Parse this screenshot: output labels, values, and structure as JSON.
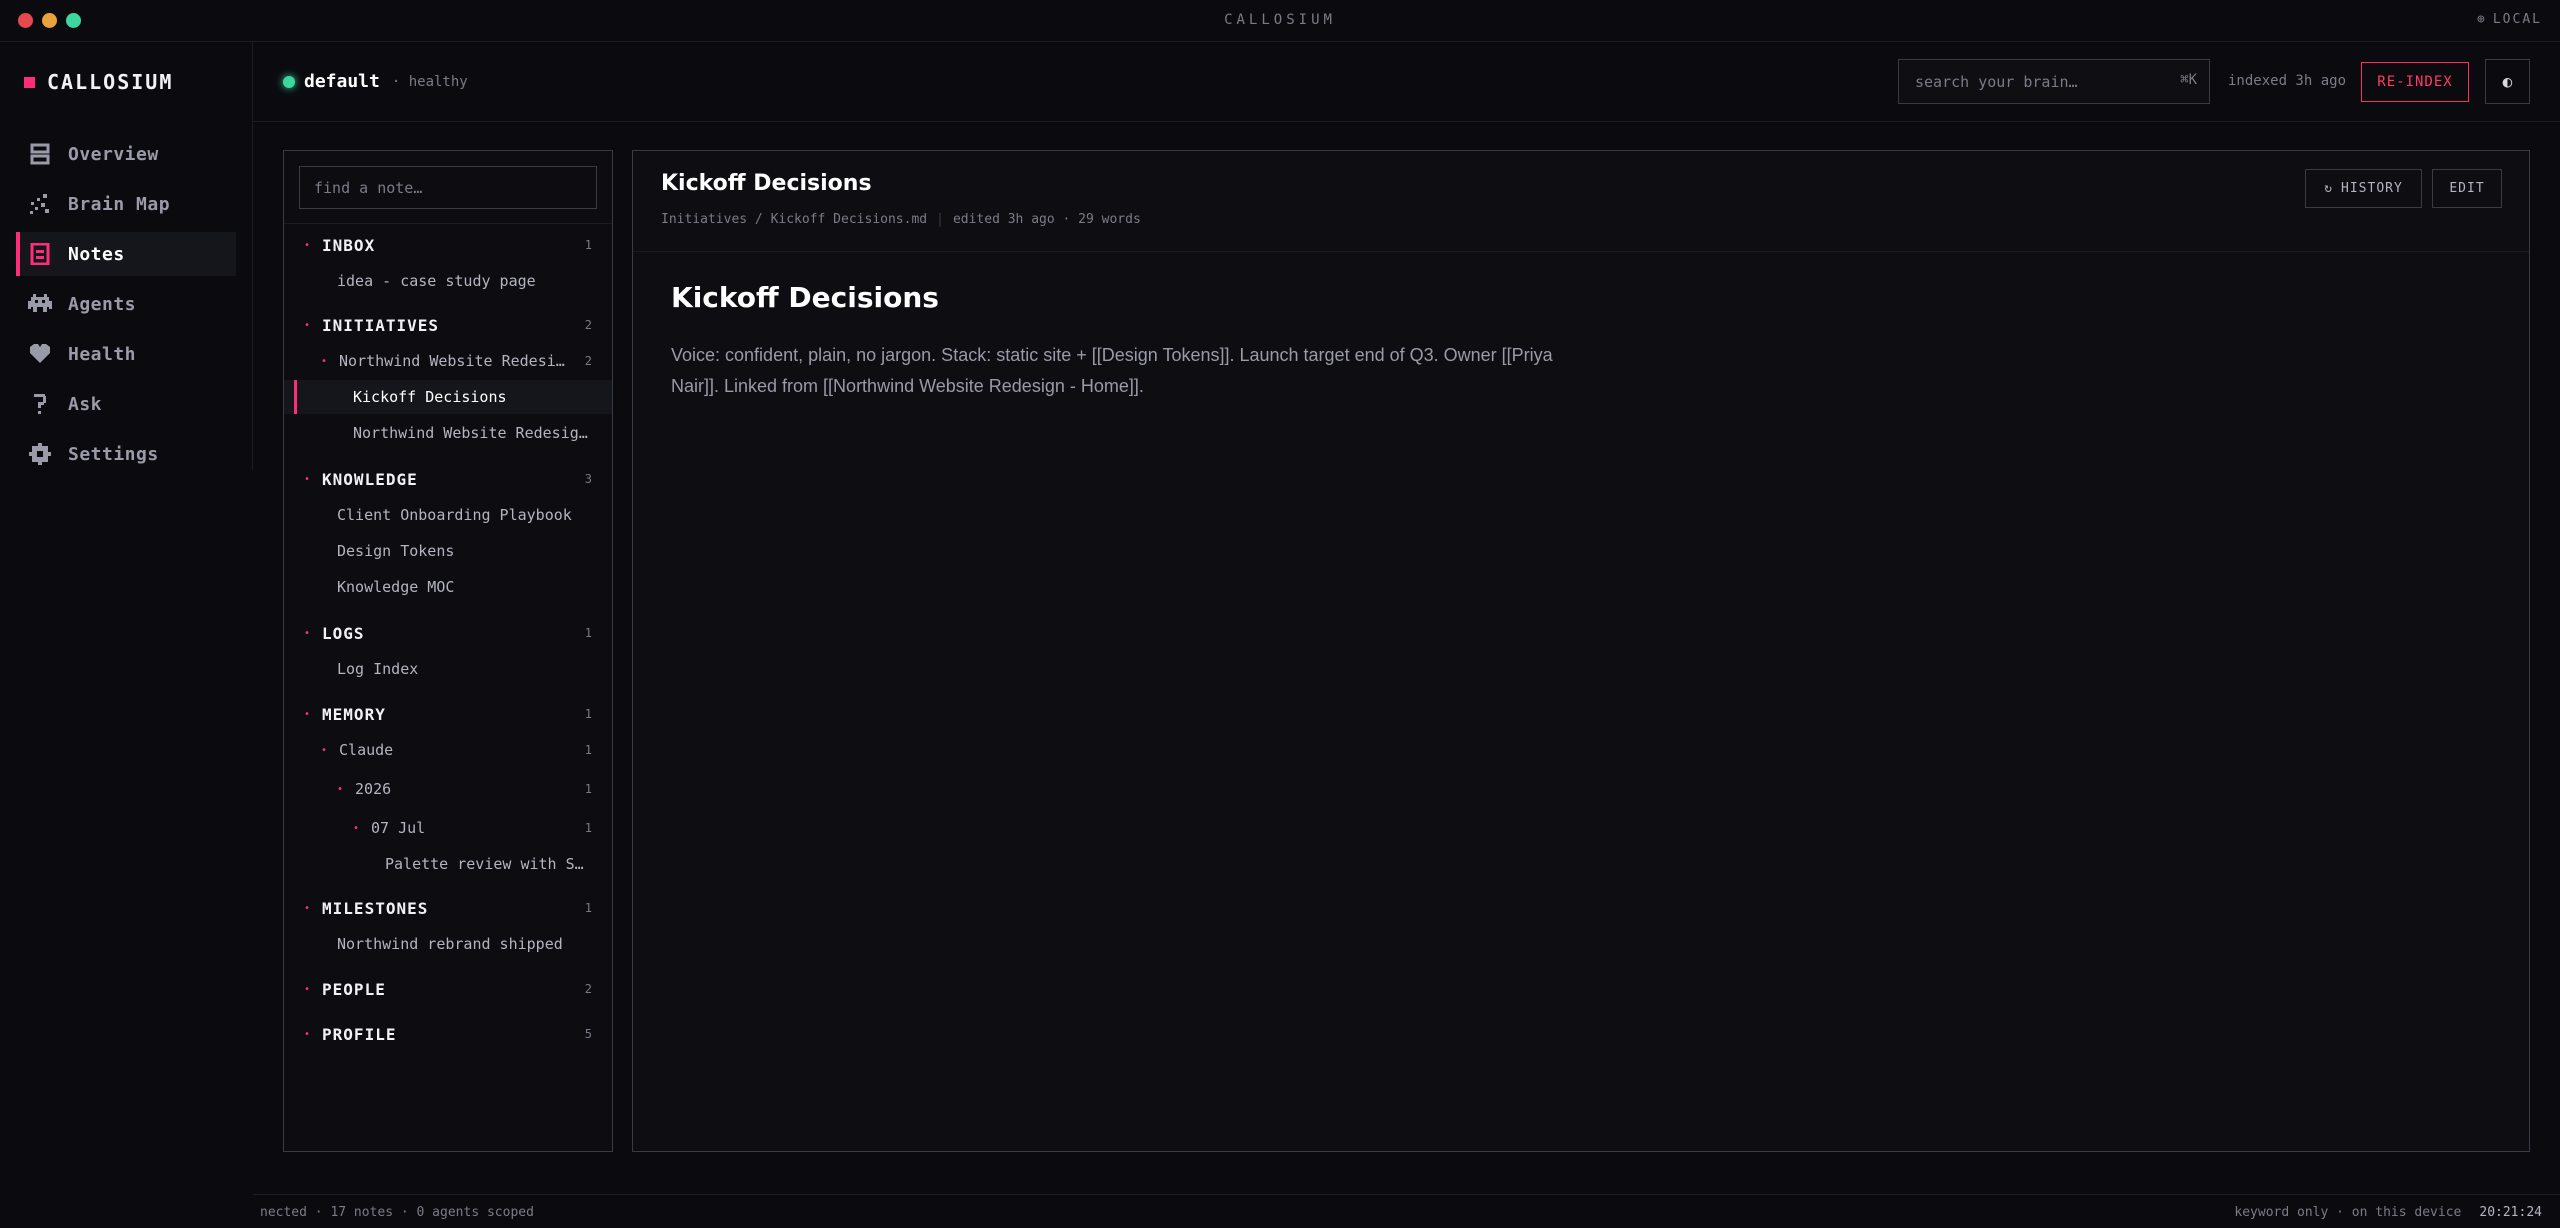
{
  "window": {
    "title": "CALLOSIUM",
    "mode": "LOCAL"
  },
  "sidebar": {
    "brand": "CALLOSIUM",
    "items": [
      {
        "label": "Overview",
        "icon": "overview-icon"
      },
      {
        "label": "Brain Map",
        "icon": "brain-map-icon"
      },
      {
        "label": "Notes",
        "icon": "notes-icon",
        "active": true
      },
      {
        "label": "Agents",
        "icon": "agents-icon"
      },
      {
        "label": "Health",
        "icon": "heart-icon"
      },
      {
        "label": "Ask",
        "icon": "question-icon"
      },
      {
        "label": "Settings",
        "icon": "gear-icon"
      }
    ]
  },
  "topbar": {
    "workspace": "default",
    "status": "· healthy",
    "search_placeholder": "search your brain…",
    "search_shortcut": "⌘K",
    "indexed": "indexed 3h ago",
    "reindex_label": "RE-INDEX",
    "theme_icon": "◐"
  },
  "tree": {
    "filter_placeholder": "find a note…",
    "rows": [
      {
        "label": "INBOX",
        "count": "1",
        "section": true,
        "depth": 0
      },
      {
        "label": "idea - case study page",
        "depth": 1,
        "leaf": true
      },
      {
        "label": "INITIATIVES",
        "count": "2",
        "section": true,
        "depth": 0
      },
      {
        "label": "Northwind Website Redesign",
        "count": "2",
        "depth": 1
      },
      {
        "label": "Kickoff Decisions",
        "depth": 2,
        "leaf": true,
        "selected": true
      },
      {
        "label": "Northwind Website Redesign - Home",
        "depth": 2,
        "leaf": true
      },
      {
        "label": "KNOWLEDGE",
        "count": "3",
        "section": true,
        "depth": 0
      },
      {
        "label": "Client Onboarding Playbook",
        "depth": 1,
        "leaf": true
      },
      {
        "label": "Design Tokens",
        "depth": 1,
        "leaf": true
      },
      {
        "label": "Knowledge MOC",
        "depth": 1,
        "leaf": true
      },
      {
        "label": "LOGS",
        "count": "1",
        "section": true,
        "depth": 0
      },
      {
        "label": "Log Index",
        "depth": 1,
        "leaf": true
      },
      {
        "label": "MEMORY",
        "count": "1",
        "section": true,
        "depth": 0
      },
      {
        "label": "Claude",
        "count": "1",
        "depth": 1
      },
      {
        "label": "2026",
        "count": "1",
        "depth": 2
      },
      {
        "label": "07 Jul",
        "count": "1",
        "depth": 3
      },
      {
        "label": "Palette review with Sam",
        "depth": 4,
        "leaf": true
      },
      {
        "label": "MILESTONES",
        "count": "1",
        "section": true,
        "depth": 0
      },
      {
        "label": "Northwind rebrand shipped",
        "depth": 1,
        "leaf": true
      },
      {
        "label": "PEOPLE",
        "count": "2",
        "section": true,
        "depth": 0
      },
      {
        "label": "PROFILE",
        "count": "5",
        "section": true,
        "depth": 0
      }
    ]
  },
  "note": {
    "title": "Kickoff Decisions",
    "path": "Initiatives / Kickoff Decisions.md",
    "edited": "edited 3h ago · 29 words",
    "history_label": "HISTORY",
    "edit_label": "EDIT",
    "heading": "Kickoff Decisions",
    "body": "Voice: confident, plain, no jargon. Stack: static site + [[Design Tokens]]. Launch target end of Q3. Owner [[Priya Nair]]. Linked from [[Northwind Website Redesign - Home]]."
  },
  "statusbar": {
    "left": "nected · 17 notes · 0 agents scoped",
    "right": "keyword only · on this device",
    "clock": "20:21:24"
  }
}
